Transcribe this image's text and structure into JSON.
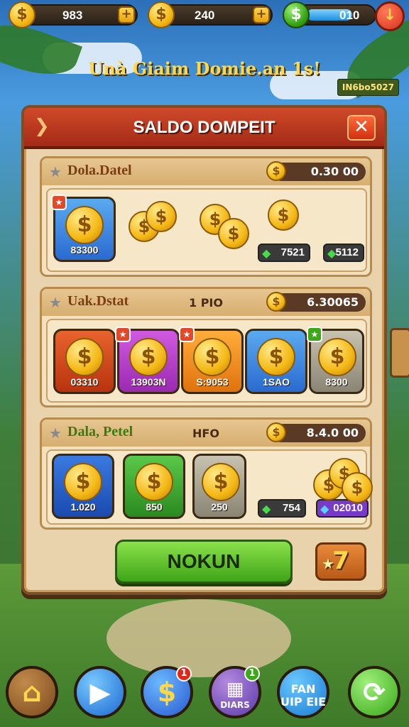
{
  "colors": {
    "primary_red": "#d04a2a",
    "panel_bg": "#e9d3ad",
    "cta_green": "#3fa418",
    "coin_gold": "#f4b814"
  },
  "topbar": {
    "coins_value": "983",
    "gems_value": "240",
    "energy_value": "010",
    "energy_fill": 0.7
  },
  "headline": "Unà Giaim Domie.an 1s!",
  "tag": "IN6bo5027",
  "panel": {
    "title": "SALDO DOMPEIT",
    "sections": [
      {
        "title": "Dola.Datel",
        "mid": "",
        "balance": "0.30 00",
        "tiles": [
          {
            "label": "83300",
            "color": "#3a8ee6"
          }
        ],
        "chips": [
          "7521",
          "5112"
        ]
      },
      {
        "title": "Uak.Dstat",
        "mid": "1 PIO",
        "balance": "6.30065",
        "tiles": [
          {
            "label": "03310",
            "color": "#d84a1e"
          },
          {
            "label": "13903N",
            "color": "#b43ac8"
          },
          {
            "label": "S:9053",
            "color": "#f0921e"
          },
          {
            "label": "1SAO",
            "color": "#3a8ee6"
          },
          {
            "label": "8300",
            "color": "#9a9a8a"
          }
        ]
      },
      {
        "title": "Dala, Petel",
        "mid": "HFO",
        "balance": "8.4.0 00",
        "tiles": [
          {
            "label": "1.020",
            "color": "#2a6ad0"
          },
          {
            "label": "850",
            "color": "#3aa830"
          },
          {
            "label": "250",
            "color": "#9a9a8a"
          }
        ],
        "chips": [
          "754",
          "02010"
        ]
      }
    ],
    "cta_label": "NOKUN",
    "bonus_label": "7"
  },
  "nav": {
    "items": [
      {
        "icon": "home-icon",
        "caption": ""
      },
      {
        "icon": "play-icon",
        "caption": ""
      },
      {
        "icon": "dollar-icon",
        "caption": "",
        "badge": "1"
      },
      {
        "icon": "card-icon",
        "caption": "DIARS",
        "badge": "1"
      },
      {
        "icon": "fan-icon",
        "caption": "FAN UIP EIE"
      },
      {
        "icon": "refresh-icon",
        "caption": ""
      }
    ]
  }
}
